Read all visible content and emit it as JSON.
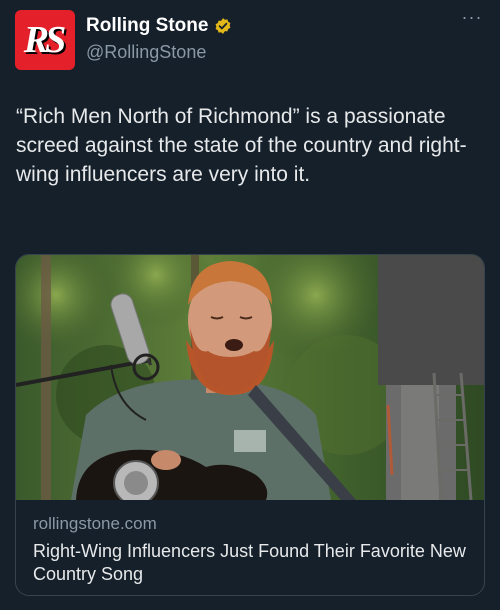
{
  "account": {
    "display_name": "Rolling Stone",
    "handle": "@RollingStone",
    "avatar_text": "RS",
    "verified_color": "#e2b719",
    "brand_color": "#e4202b"
  },
  "more_button": {
    "icon": "more-horizontal-icon",
    "glyph": "···"
  },
  "tweet": {
    "text": "“Rich Men North of Richmond” is a passionate screed against the state of the country and right-wing influencers are very into it."
  },
  "card": {
    "domain": "rollingstone.com",
    "title": "Right-Wing Influencers Just Found Their Favorite New Country Song",
    "image_description_icon": "photo-icon"
  },
  "colors": {
    "background": "#15202b",
    "text_secondary": "#8b98a5",
    "border": "#38444d"
  }
}
